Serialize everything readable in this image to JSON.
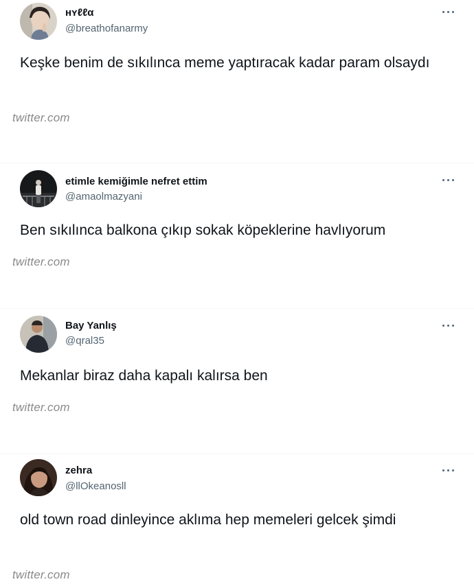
{
  "tweets": [
    {
      "name": "ʜʏℓℓα",
      "handle": "@breathofanarmy",
      "text": "Keşke benim de sıkılınca meme yaptıracak kadar param olsaydı",
      "source": "twitter.com"
    },
    {
      "name": "etimle kemiğimle nefret ettim",
      "handle": "@amaolmazyani",
      "text": "Ben sıkılınca balkona çıkıp sokak köpeklerine havlıyorum",
      "source": "twitter.com"
    },
    {
      "name": "Bay Yanlış",
      "handle": "@qral35",
      "text": "Mekanlar biraz daha kapalı kalırsa ben",
      "source": "twitter.com"
    },
    {
      "name": "zehra",
      "handle": "@llOkeanosll",
      "text": "old town road dinleyince aklıma hep memeleri gelcek şimdi",
      "source": "twitter.com"
    }
  ],
  "icons": {
    "more": "more-options-icon",
    "avatar": "profile-photo"
  }
}
